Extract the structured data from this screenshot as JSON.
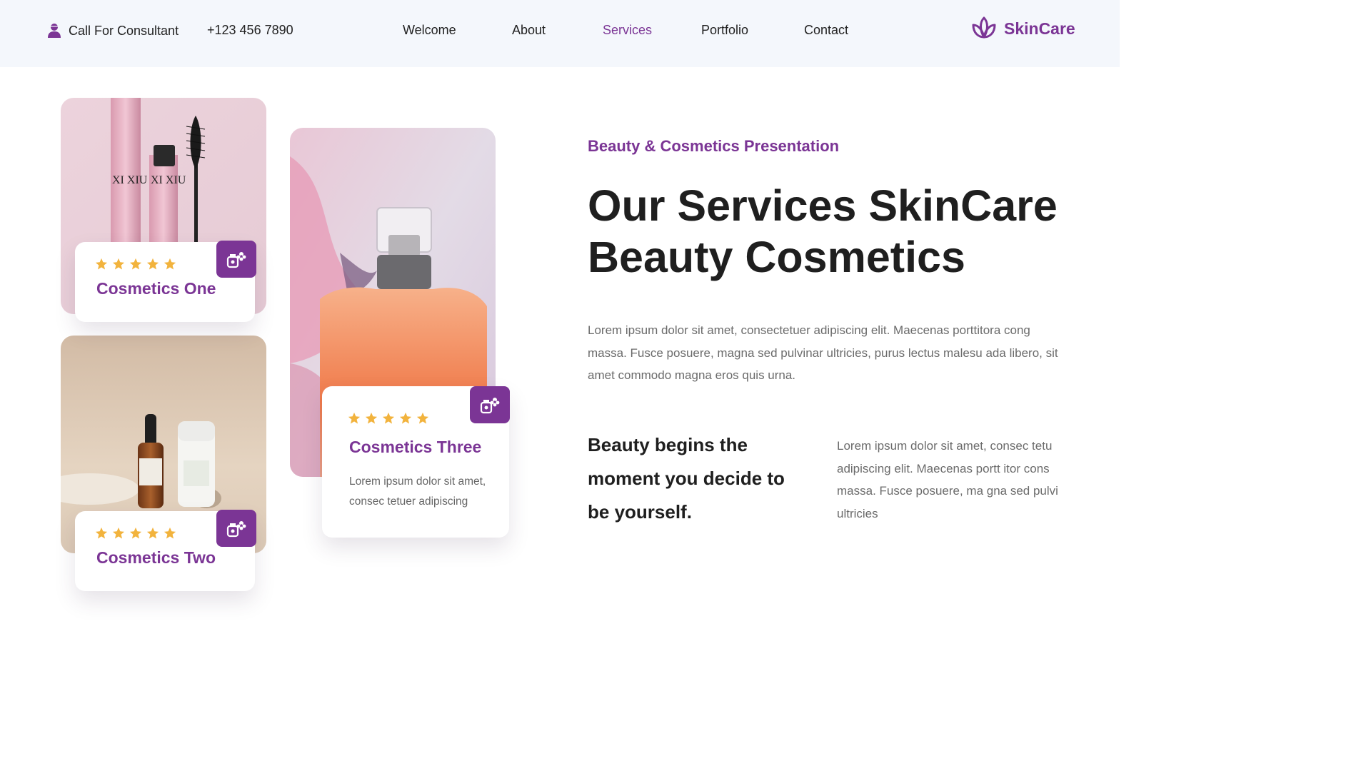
{
  "header": {
    "consult_label": "Call For Consultant",
    "phone": "+123 456 7890",
    "nav": [
      {
        "label": "Welcome",
        "active": false
      },
      {
        "label": "About",
        "active": false
      },
      {
        "label": "Services",
        "active": true
      },
      {
        "label": "Portfolio",
        "active": false
      },
      {
        "label": "Contact",
        "active": false
      }
    ],
    "brand": "SkinCare"
  },
  "cards": [
    {
      "title": "Cosmetics One",
      "rating": 5,
      "image": "mascara-photo",
      "icon": "flower-bottle-icon"
    },
    {
      "title": "Cosmetics Two",
      "rating": 5,
      "image": "serum-bottles-photo",
      "icon": "flower-bottle-icon"
    },
    {
      "title": "Cosmetics Three",
      "rating": 5,
      "image": "perfume-photo",
      "icon": "flower-bottle-icon",
      "description": "Lorem ipsum dolor sit amet, consec tetuer adipiscing"
    }
  ],
  "main": {
    "eyebrow": "Beauty & Cosmetics Presentation",
    "headline_line1": "Our Services SkinCare",
    "headline_line2": "Beauty Cosmetics",
    "paragraph": "Lorem ipsum dolor sit amet, consectetuer adipiscing elit. Maecenas porttitora cong massa. Fusce posuere, magna sed pulvinar ultricies, purus lectus malesu ada libero, sit amet commodo magna eros quis urna.",
    "quote": "Beauty begins the moment you decide to be yourself.",
    "paragraph2": "Lorem ipsum dolor sit amet, consec tetu adipiscing elit. Maecenas portt itor cons massa. Fusce posuere, ma gna sed pulvi ultricies"
  },
  "colors": {
    "accent": "#7b3595",
    "star": "#f2b33d",
    "header_bg": "#f4f7fc",
    "text_dark": "#1f1f1f",
    "text_muted": "#6b6b6b"
  }
}
